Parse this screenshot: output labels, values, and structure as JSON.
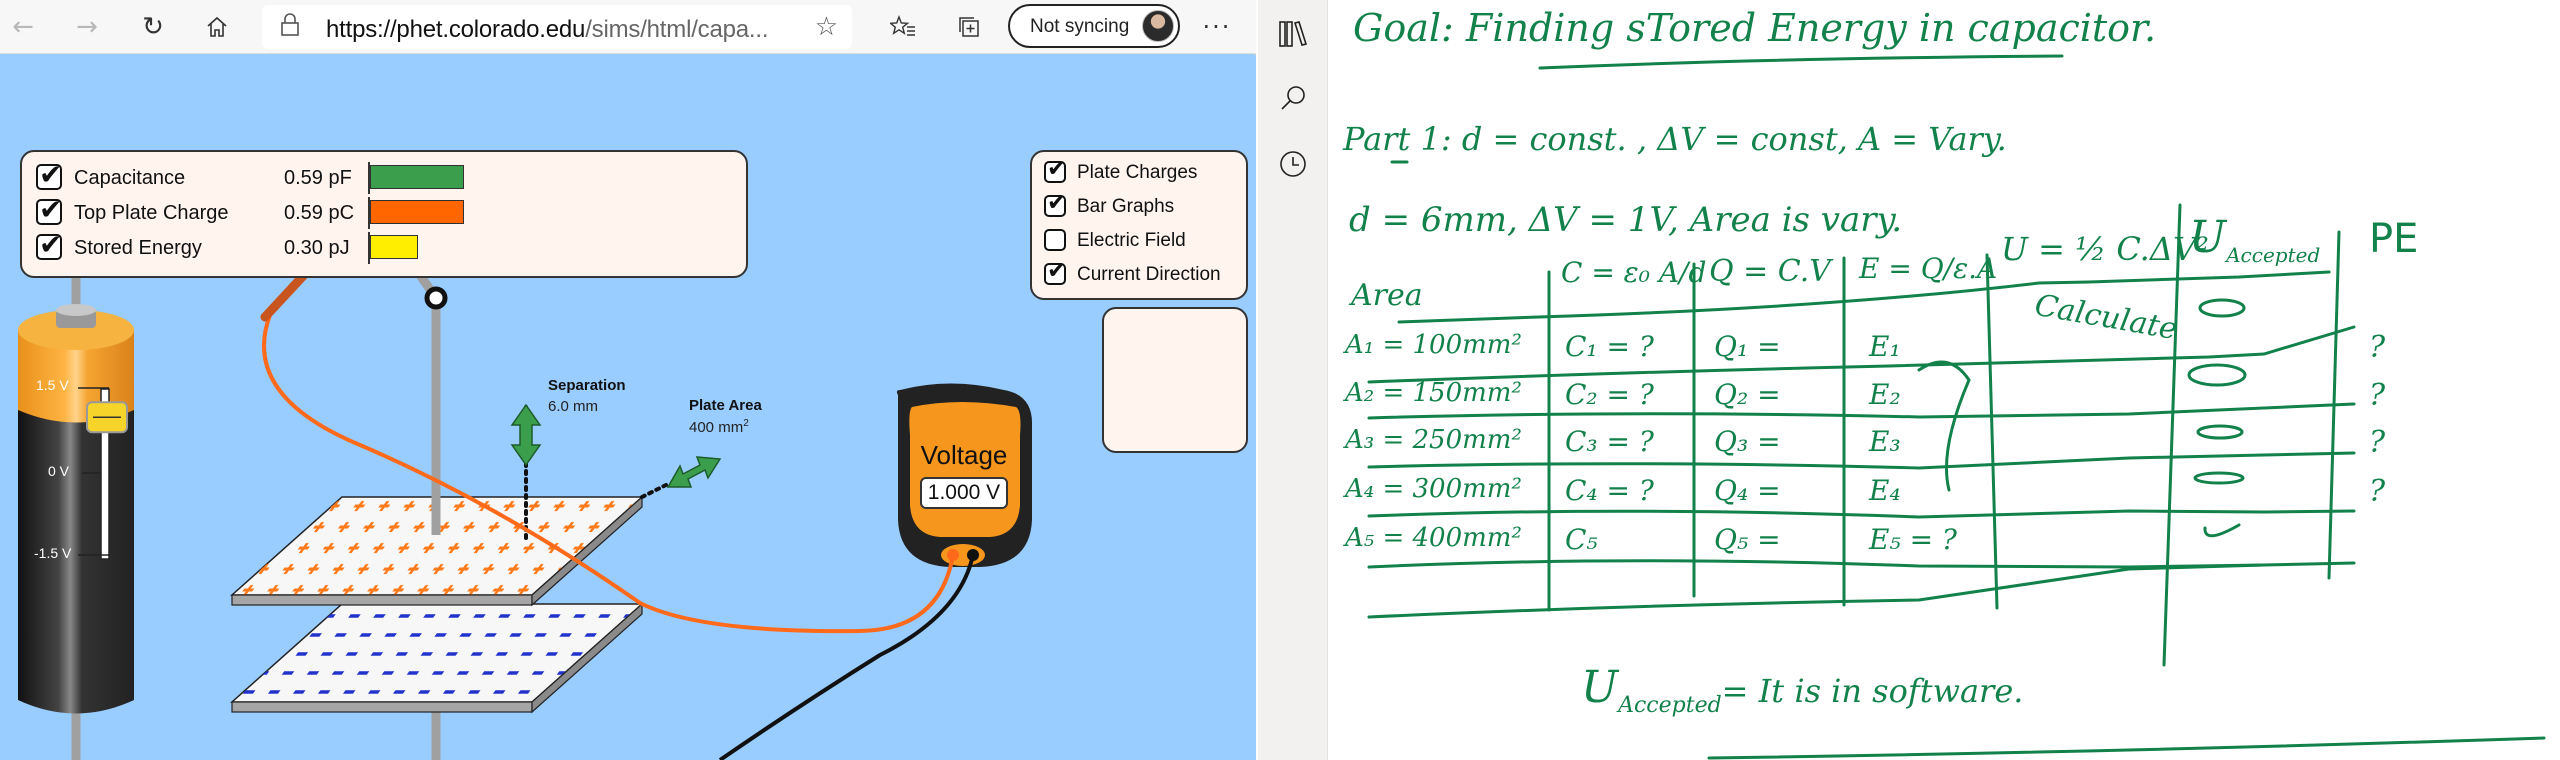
{
  "browser": {
    "url_host": "https://phet.colorado.edu",
    "url_rest": "/sims/html/capa...",
    "sync_label": "Not syncing",
    "icons": {
      "back": "arrow-left-icon",
      "forward": "arrow-right-icon",
      "refresh": "refresh-icon",
      "home": "home-icon",
      "lock": "lock-icon",
      "favorite": "star-icon",
      "favorites": "favorites-list-icon",
      "collections": "collections-icon",
      "more": "more-icon"
    }
  },
  "sim": {
    "readouts": [
      {
        "label": "Capacitance",
        "value": "0.59 pF",
        "checked": true,
        "color": "#3a9e4c",
        "fraction": 0.59
      },
      {
        "label": "Top Plate Charge",
        "value": "0.59 pC",
        "checked": true,
        "color": "#ff6600",
        "fraction": 0.59
      },
      {
        "label": "Stored Energy",
        "value": "0.30 pJ",
        "checked": true,
        "color": "#ffee00",
        "fraction": 0.3
      }
    ],
    "options": [
      {
        "label": "Plate Charges",
        "checked": true
      },
      {
        "label": "Bar Graphs",
        "checked": true
      },
      {
        "label": "Electric Field",
        "checked": false
      },
      {
        "label": "Current Direction",
        "checked": true
      }
    ],
    "separation_label": "Separation",
    "separation_value": "6.0 mm",
    "plate_area_label": "Plate Area",
    "plate_area_value": "400 mm",
    "plate_area_unit_sup": "2",
    "battery": {
      "max_label": "1.5 V",
      "zero_label": "0 V",
      "min_label": "-1.5 V",
      "voltage_fraction": 0.83
    },
    "voltmeter": {
      "title": "Voltage",
      "reading": "1.000 V"
    }
  },
  "notes": {
    "nav_icons": [
      "notebooks-icon",
      "search-icon",
      "recent-icon"
    ],
    "lines": {
      "goal": "Goal:  Finding  sTored Energy in capacitor.",
      "part1": "Part 1:   d = const. ,  ΔV = const,   A = Vary.",
      "given": "d = 6mm,  ΔV = 1V,   Area is vary.",
      "footer_u": "U",
      "footer_sub": "Accepted",
      "footer_rest": "= It is in software."
    },
    "table": {
      "headers": [
        "Area",
        "C = ε₀ A/d",
        "Q = C.V",
        "E = Q/ε.A",
        "U = ½ C.ΔV²",
        "U",
        "PE"
      ],
      "header_u_sub": "Accepted",
      "rows": [
        [
          "A₁ = 100mm²",
          "C₁ = ?",
          "Q₁ =",
          "E₁",
          "Calculate",
          "0",
          "?"
        ],
        [
          "A₂ = 150mm²",
          "C₂ = ?",
          "Q₂ =",
          "E₂",
          "",
          "0",
          "?"
        ],
        [
          "A₃ = 250mm²",
          "C₃ = ?",
          "Q₃ =",
          "E₃",
          "",
          "0",
          "?"
        ],
        [
          "A₄ = 300mm²",
          "C₄ = ?",
          "Q₄ =",
          "E₄",
          "",
          "✓",
          "?"
        ],
        [
          "A₅ = 400mm²",
          "C₅",
          "Q₅ =",
          "E₅ = ?",
          "",
          "",
          ""
        ]
      ]
    }
  }
}
